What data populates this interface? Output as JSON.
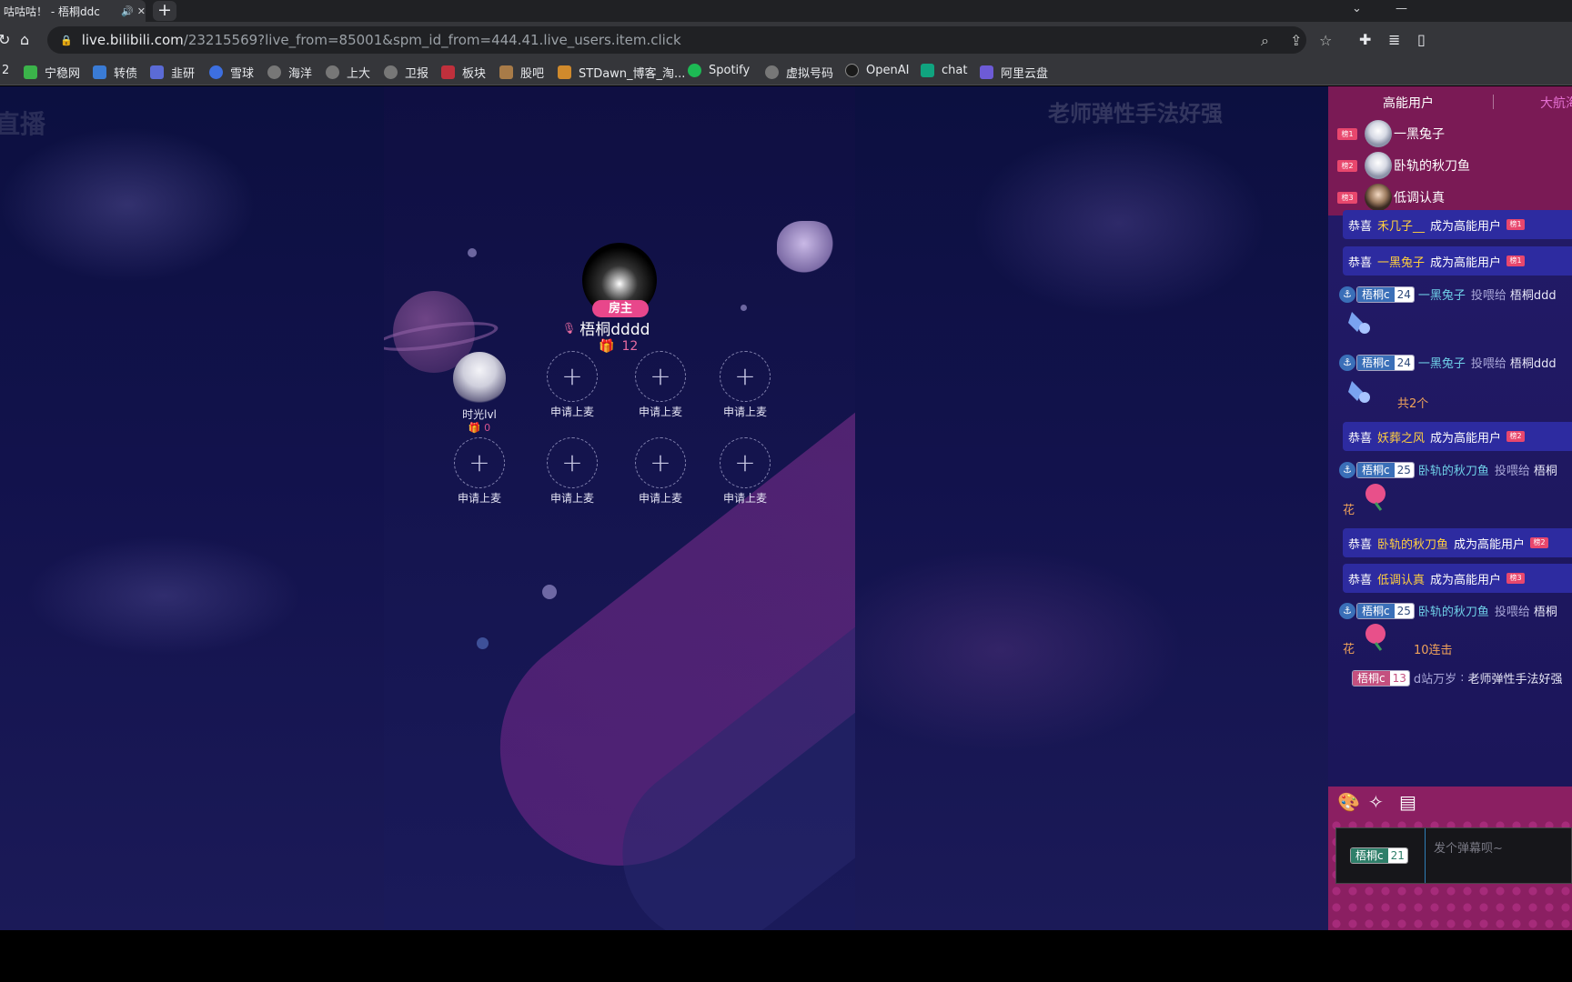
{
  "browser": {
    "tab_title": "咕咕咕！ - 梧桐ddc",
    "tab_left_marker": "",
    "url_host": "live.bilibili.com",
    "url_path": "/23215569?live_from=85001&spm_id_from=444.41.live_users.item.click",
    "bookmarks": [
      "2",
      "宁稳网",
      "转债",
      "韭研",
      "雪球",
      "海洋",
      "上大",
      "卫报",
      "板块",
      "股吧",
      "STDawn_博客_淘...",
      "Spotify",
      "虚拟号码",
      "OpenAI",
      "chat",
      "阿里云盘"
    ],
    "bookmark_colors": [
      "#888888",
      "#3bb34a",
      "#3a7bd5",
      "#5b6bd6",
      "#3d6fe0",
      "#777777",
      "#777777",
      "#777777",
      "#c0303c",
      "#a87b48",
      "#d08a2c",
      "#1db954",
      "#777777",
      "#1a1a1a",
      "#10a37f",
      "#6d5bd6"
    ]
  },
  "stage": {
    "watermark_left": "直播",
    "watermark_right": "老师弹性手法好强"
  },
  "room": {
    "host_badge": "房主",
    "host_name": "梧桐dddd",
    "host_gift_count": "12",
    "seat_user_name": "时光lvl",
    "seat_user_gift": "0",
    "empty_seat_label": "申请上麦"
  },
  "panel": {
    "tab_high_energy": "高能用户",
    "tab_captain": "大航海",
    "ranks": [
      {
        "badge": "榜1",
        "name": "一黑兔子"
      },
      {
        "badge": "榜2",
        "name": "卧轨的秋刀鱼"
      },
      {
        "badge": "榜3",
        "name": "低调认真"
      }
    ],
    "cong_prefix": "恭喜",
    "cong_suffix": "成为高能用户",
    "cong_rows": [
      {
        "name": "禾几子__",
        "badge": "榜1"
      },
      {
        "name": "一黑兔子",
        "badge": "榜1"
      },
      {
        "name": "妖葬之风",
        "badge": "榜2"
      },
      {
        "name": "卧轨的秋刀鱼",
        "badge": "榜2"
      },
      {
        "name": "低调认真",
        "badge": "榜3"
      }
    ],
    "gift_lines": [
      {
        "medal_name": "梧桐c",
        "medal_level": "24",
        "user": "一黑兔子",
        "action": "投喂给",
        "target": "梧桐ddd"
      },
      {
        "medal_name": "梧桐c",
        "medal_level": "24",
        "user": "一黑兔子",
        "action": "投喂给",
        "target": "梧桐ddd"
      },
      {
        "medal_name": "梧桐c",
        "medal_level": "25",
        "user": "卧轨的秋刀鱼",
        "action": "投喂给",
        "target": "梧桐"
      },
      {
        "medal_name": "梧桐c",
        "medal_level": "25",
        "user": "卧轨的秋刀鱼",
        "action": "投喂给",
        "target": "梧桐"
      }
    ],
    "gift_sub_total": "共2个",
    "flower_label": "花",
    "combo": "10连击",
    "danmaku": {
      "medal_name": "梧桐c",
      "medal_level": "13",
      "user": "d站万岁",
      "text": "老师弹性手法好强"
    },
    "input_medal_name": "梧桐c",
    "input_medal_level": "21",
    "input_placeholder": "发个弹幕呗~"
  }
}
